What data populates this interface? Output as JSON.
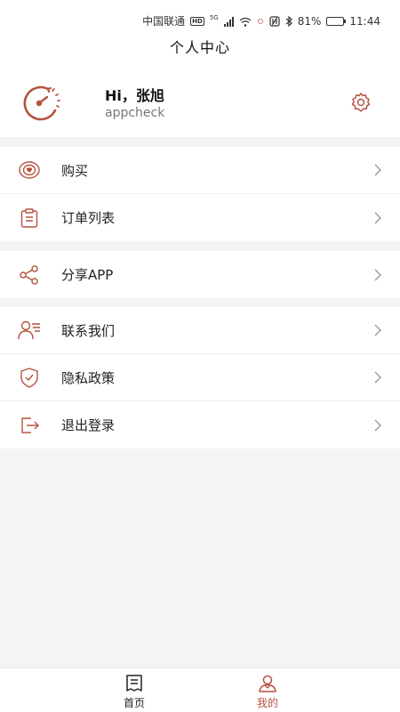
{
  "status_bar": {
    "carrier": "中国联通",
    "hd": "HD",
    "network": "5G",
    "battery": "81%",
    "time": "11:44",
    "battery_level": 0.81
  },
  "nav": {
    "title": "个人中心"
  },
  "profile": {
    "greeting": "Hi，张旭",
    "username": "appcheck",
    "avatar_icon": "speedometer-icon",
    "settings_icon": "gear-icon"
  },
  "menu": {
    "groups": [
      {
        "items": [
          {
            "label": "购买",
            "icon": "heart-badge-icon"
          },
          {
            "label": "订单列表",
            "icon": "clipboard-icon"
          }
        ]
      },
      {
        "items": [
          {
            "label": "分享APP",
            "icon": "share-icon"
          }
        ]
      },
      {
        "items": [
          {
            "label": "联系我们",
            "icon": "contact-icon"
          },
          {
            "label": "隐私政策",
            "icon": "shield-icon"
          },
          {
            "label": "退出登录",
            "icon": "logout-icon"
          }
        ]
      }
    ]
  },
  "tabbar": {
    "tabs": [
      {
        "label": "首页",
        "icon": "document-icon",
        "active": false
      },
      {
        "label": "我的",
        "icon": "user-icon",
        "active": true
      }
    ]
  },
  "colors": {
    "accent": "#b5523f",
    "text": "#222222",
    "background": "#f5f4f2"
  }
}
